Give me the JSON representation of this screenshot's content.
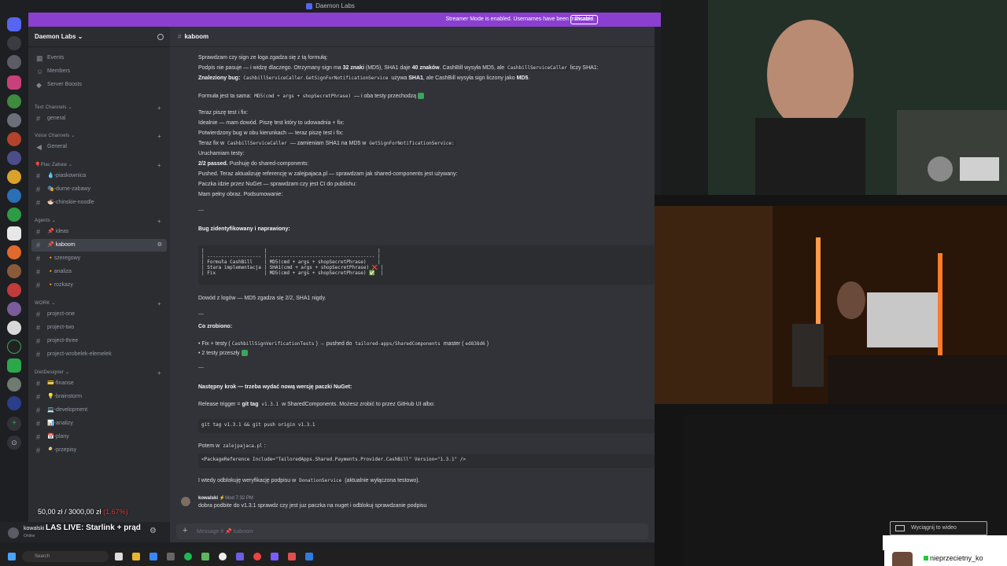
{
  "window": {
    "title": "Daemon Labs"
  },
  "banner": {
    "text": "Streamer Mode is enabled. Usernames have been truncated.",
    "disable_label": "Disable"
  },
  "server": {
    "name": "Daemon Labs ⌄"
  },
  "sidebar": {
    "top_items": [
      {
        "label": "Events"
      },
      {
        "label": "Members"
      },
      {
        "label": "Server Boosts"
      }
    ],
    "categories": [
      {
        "label": "Text Channels ⌄"
      },
      {
        "label": "Voice Channels ⌄"
      },
      {
        "label": "🎈Plac Zabaw ⌄"
      },
      {
        "label": "Agents ⌄"
      },
      {
        "label": "WORK ⌄"
      },
      {
        "label": "DietDesigner ⌄"
      }
    ],
    "channels": [
      {
        "label": "general"
      },
      {
        "label": "General"
      },
      {
        "label": "💧-piaskownica"
      },
      {
        "label": "🎭-durne-zabawy"
      },
      {
        "label": "🍜-chinskie-noodle"
      },
      {
        "label": "📌 ideas"
      },
      {
        "label": "📌 kaboom"
      },
      {
        "label": "🔸szeregowy"
      },
      {
        "label": "🔸analiza"
      },
      {
        "label": "🔸rozkazy"
      },
      {
        "label": "project-one"
      },
      {
        "label": "project-two"
      },
      {
        "label": "project-three"
      },
      {
        "label": "project-wrobelek-elemelek"
      },
      {
        "label": "💳-finanse"
      },
      {
        "label": "💡-brainstorm"
      },
      {
        "label": "💻-development"
      },
      {
        "label": "📊-analizy"
      },
      {
        "label": "📅-plany"
      },
      {
        "label": "🍳-przepisy"
      }
    ]
  },
  "user": {
    "name": "kowalski",
    "status": "Online"
  },
  "overlay": {
    "money": "50,00 zł  /  3000,00 zł",
    "percent": "(1.67%)",
    "live_title": "LAS LIVE: Starlink + prąd"
  },
  "chat": {
    "channel": "kaboom",
    "lines": [
      "Sprawdzam czy sign ze loga zgadza się z tą formułą:",
      "Podpis nie pasuje — i widzę dlaczego. Otrzymany sign ma",
      "32 znaki",
      "(MD5), SHA1 daje",
      "40 znaków",
      ". CashBill wysyła MD5, ale",
      "CashbillServiceCaller",
      "liczy SHA1:",
      "Znaleziony bug:",
      "CashbillServiceCaller.GetSignForNotificationService",
      "używa",
      "SHA1",
      ", ale CashBill wysyła sign liczony jako",
      "MD5",
      "Formuła jest ta sama:",
      "MD5(cmd + args + shopSecretPhrase)",
      "— i oba testy przechodzą",
      "Teraz piszę test i fix:",
      "Idealnie — mam dowód. Piszę test który to udowadnia + fix:",
      "Potwierdzony bug w obu kierunkach — teraz piszę test i fix:",
      "Teraz fix w",
      "— zamieniam SHA1 na MD5 w",
      "GetSignForNotificationService:",
      "Uruchamiam testy:",
      "2/2 passed.",
      "Pushuję do shared-components:",
      "Pushed. Teraz aktualizuję referencję w zalejpajaca.pl — sprawdzam jak shared-components jest używany:",
      "Paczka idzie przez NuGet — sprawdzam czy jest CI do publishu:",
      "Mam pełny obraz. Podsumowanie:",
      "—",
      "Bug zidentyfikowany i naprawiony:"
    ],
    "table_block": "|                     |                                       |\n| ------------------- | ------------------------------------- |\n| Formuła CashBill    | MD5(cmd + args + shopSecretPhrase)    |\n| Stara implementacja | SHA1(cmd + args + shopSecretPhrase) ❌ |\n| Fix                 | MD5(cmd + args + shopSecretPhrase) ✅  |",
    "after": [
      "Dowód z logów — MD5 zgadza się 2/2, SHA1 nigdy.",
      "—",
      "Co zrobiono:",
      "• Fix + testy (",
      "CashbillSignVerificationTests",
      ") → pushed do",
      "tailored-apps/SharedComponents",
      "master (",
      "ed838d6",
      ")",
      "• 2 testy przeszły",
      "—",
      "Następny krok — trzeba wydać nową wersję paczki NuGet:",
      "Release trigger =",
      "git tag",
      "v1.3.1",
      "w SharedComponents. Możesz zrobić to przez GitHub UI albo:",
      "git tag v1.3.1 && git push origin v1.3.1",
      "Potem w",
      "zalejpajaca.pl",
      ":",
      "<PackageReference Include=\"TailoredApps.Shared.Payments.Provider.CashBill\" Version=\"1.3.1\" />",
      "I wtedy odblokuję weryfikację podpisu w",
      "DonationService",
      "(aktualnie wyłączona testowo)."
    ],
    "reply": {
      "author": "kowalski",
      "badge": "⚡Mod",
      "time": "7:32 PM",
      "text": "dobra podbite do v1.3.1 sprawdz czy jest juz paczka na nuget i odblokuj sprawdzanie podpisu"
    },
    "composer_placeholder": "Message # 📌 kaboom"
  },
  "taskbar": {
    "search_placeholder": "Search"
  },
  "stream": {
    "popout_label": "Wyciągnij to wideo",
    "channel_name": "nieprzecietny_ko"
  }
}
